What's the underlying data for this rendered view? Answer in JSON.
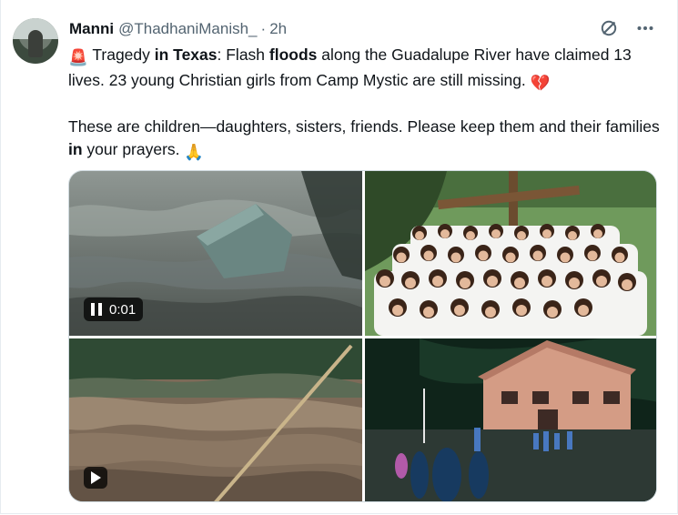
{
  "post": {
    "display_name": "Manni",
    "handle": "@ThadhaniManish_",
    "separator": "·",
    "time": "2h",
    "paragraph1": {
      "emoji_siren": "🚨",
      "t1": " Tragedy ",
      "b1": "in Texas",
      "t2": ": Flash ",
      "b2": "floods",
      "t3": " along the Guadalupe River have claimed 13 lives. 23 young Christian girls from Camp Mystic are still missing. ",
      "emoji_heart": "💔"
    },
    "paragraph2": {
      "t1": "These are children—daughters, sisters, friends. Please keep them and their families ",
      "b1": "in",
      "t2": " your prayers. ",
      "emoji_pray": "🙏"
    },
    "icons": {
      "grok": "slashed-circle-icon",
      "more": "more-dots-icon"
    }
  },
  "media": {
    "video1": {
      "time": "0:01",
      "state": "paused",
      "icon": "pause-icon"
    },
    "video2": {
      "icon": "play-icon"
    },
    "image1": {
      "description": ""
    },
    "image2": {
      "description": ""
    }
  }
}
